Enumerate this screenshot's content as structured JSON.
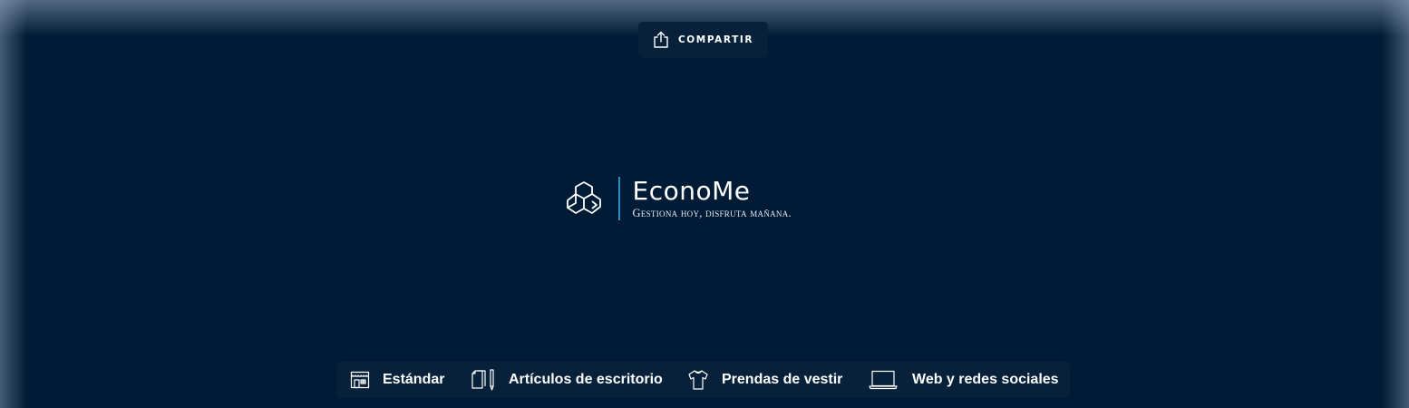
{
  "header": {
    "share_label": "COMPARTIR"
  },
  "brand": {
    "name": "EconoMe",
    "tagline": "Gestiona hoy, disfruta mañana.",
    "accent_color": "#2a8fc9"
  },
  "categories": [
    {
      "label": "Estándar",
      "icon": "storefront-icon"
    },
    {
      "label": "Artículos de escritorio",
      "icon": "stationery-icon"
    },
    {
      "label": "Prendas de vestir",
      "icon": "tshirt-icon"
    },
    {
      "label": "Web y redes sociales",
      "icon": "laptop-icon"
    }
  ],
  "colors": {
    "background": "#001b35",
    "panel": "#07213b",
    "text": "#ffffff"
  }
}
